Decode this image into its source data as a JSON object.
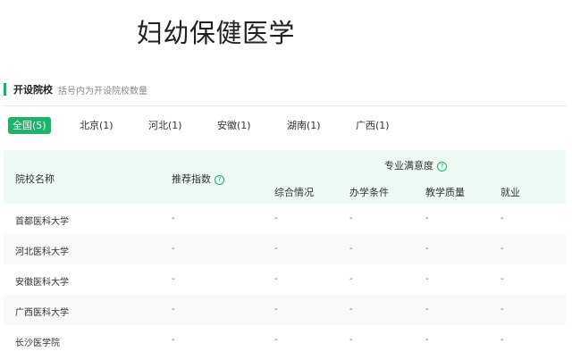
{
  "page": {
    "title": "妇幼保健医学"
  },
  "section": {
    "title": "开设院校",
    "hint": "括号内为开设院校数量"
  },
  "tabs": [
    {
      "label": "全国(5)",
      "active": true
    },
    {
      "label": "北京(1)",
      "active": false
    },
    {
      "label": "河北(1)",
      "active": false
    },
    {
      "label": "安徽(1)",
      "active": false
    },
    {
      "label": "湖南(1)",
      "active": false
    },
    {
      "label": "广西(1)",
      "active": false
    }
  ],
  "table": {
    "headers": {
      "school": "院校名称",
      "recommend": "推荐指数",
      "satisfaction": "专业满意度",
      "overall": "综合情况",
      "conditions": "办学条件",
      "quality": "教学质量",
      "employment": "就业"
    },
    "rows": [
      {
        "school": "首都医科大学",
        "recommend": "-",
        "overall": "-",
        "conditions": "-",
        "quality": "-",
        "employment": "-"
      },
      {
        "school": "河北医科大学",
        "recommend": "-",
        "overall": "-",
        "conditions": "-",
        "quality": "-",
        "employment": "-"
      },
      {
        "school": "安徽医科大学",
        "recommend": "-",
        "overall": "-",
        "conditions": "-",
        "quality": "-",
        "employment": "-"
      },
      {
        "school": "广西医科大学",
        "recommend": "-",
        "overall": "-",
        "conditions": "-",
        "quality": "-",
        "employment": "-"
      },
      {
        "school": "长沙医学院",
        "recommend": "-",
        "overall": "-",
        "conditions": "-",
        "quality": "-",
        "employment": "-"
      }
    ]
  },
  "colors": {
    "accent": "#1fb26b",
    "header_bg": "#eefbf4",
    "row_alt_bg": "#f8f9fa"
  },
  "icons": {
    "help": "question-circle-icon"
  }
}
